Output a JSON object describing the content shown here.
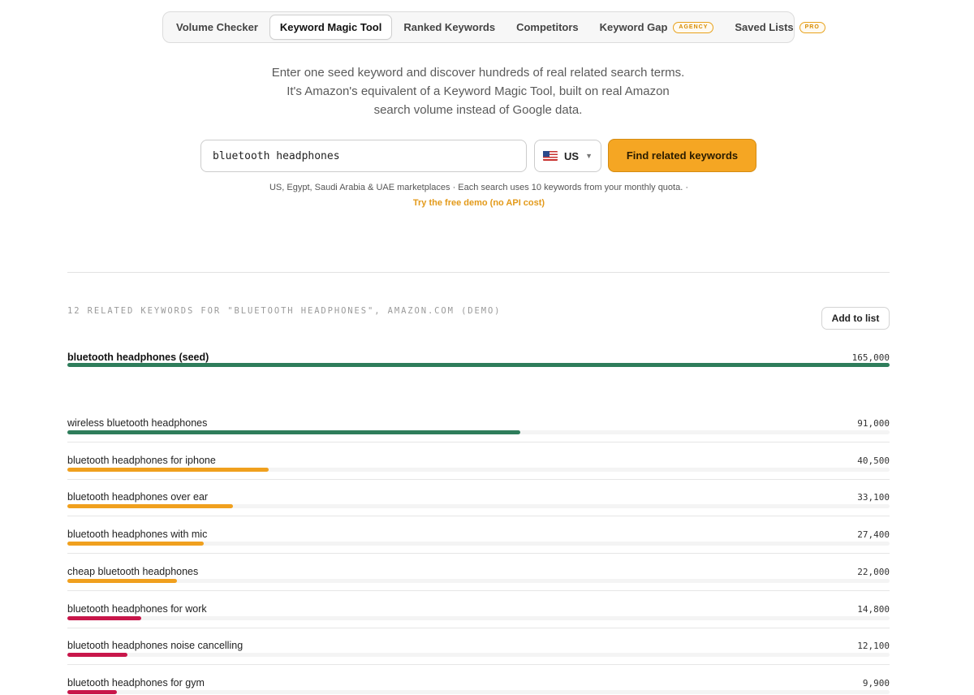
{
  "tabs": [
    {
      "label": "Volume Checker",
      "active": false,
      "badge": ""
    },
    {
      "label": "Keyword Magic Tool",
      "active": true,
      "badge": ""
    },
    {
      "label": "Ranked Keywords",
      "active": false,
      "badge": ""
    },
    {
      "label": "Competitors",
      "active": false,
      "badge": ""
    },
    {
      "label": "Keyword Gap",
      "active": false,
      "badge": "AGENCY"
    },
    {
      "label": "Saved Lists",
      "active": false,
      "badge": "PRO"
    }
  ],
  "intro": {
    "line1": "Enter one seed keyword and discover hundreds of real related search terms.",
    "line2": "It's Amazon's equivalent of a Keyword Magic Tool, built on real Amazon",
    "line3": "search volume instead of Google data."
  },
  "search": {
    "value": "bluetooth headphones",
    "market": "US",
    "button_label": "Find related keywords"
  },
  "note": {
    "text": "US, Egypt, Saudi Arabia & UAE marketplaces · Each search uses 10 keywords from your monthly quota.    ·",
    "demo_link": "Try the free demo (no API cost)"
  },
  "results": {
    "heading": "12 RELATED KEYWORDS FOR \"BLUETOOTH HEADPHONES\", AMAZON.COM (DEMO)",
    "add_button": "Add to list",
    "seed": {
      "keyword": "bluetooth headphones (seed)",
      "volume": "165,000",
      "fraction": 1.0,
      "color": "#2e7d5b"
    },
    "rows": [
      {
        "keyword": "wireless bluetooth headphones",
        "volume": "91,000",
        "fraction": 0.551,
        "color": "#2e7d5b"
      },
      {
        "keyword": "bluetooth headphones for iphone",
        "volume": "40,500",
        "fraction": 0.245,
        "color": "#f0a01e"
      },
      {
        "keyword": "bluetooth headphones over ear",
        "volume": "33,100",
        "fraction": 0.201,
        "color": "#f0a01e"
      },
      {
        "keyword": "bluetooth headphones with mic",
        "volume": "27,400",
        "fraction": 0.166,
        "color": "#f0a01e"
      },
      {
        "keyword": "cheap bluetooth headphones",
        "volume": "22,000",
        "fraction": 0.133,
        "color": "#f0a01e"
      },
      {
        "keyword": "bluetooth headphones for work",
        "volume": "14,800",
        "fraction": 0.09,
        "color": "#c8164a"
      },
      {
        "keyword": "bluetooth headphones noise cancelling",
        "volume": "12,100",
        "fraction": 0.073,
        "color": "#c8164a"
      },
      {
        "keyword": "bluetooth headphones for gym",
        "volume": "9,900",
        "fraction": 0.06,
        "color": "#c8164a"
      }
    ]
  }
}
